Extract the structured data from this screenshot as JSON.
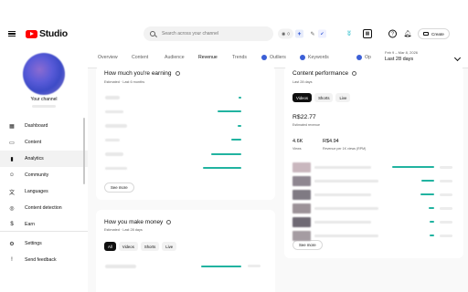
{
  "app": {
    "logo_text": "Studio"
  },
  "header": {
    "search_placeholder": "Search across your channel",
    "counter_value": "0",
    "create_label": "Create"
  },
  "sidebar": {
    "channel_name": "Your channel",
    "items": [
      {
        "label": "Dashboard",
        "icon": "dashboard-icon"
      },
      {
        "label": "Content",
        "icon": "content-icon"
      },
      {
        "label": "Analytics",
        "icon": "analytics-icon"
      },
      {
        "label": "Community",
        "icon": "community-icon"
      },
      {
        "label": "Languages",
        "icon": "languages-icon"
      },
      {
        "label": "Content detection",
        "icon": "content-detection-icon"
      },
      {
        "label": "Earn",
        "icon": "earn-icon"
      }
    ],
    "bottom_items": [
      {
        "label": "Settings",
        "icon": "gear-icon"
      },
      {
        "label": "Send feedback",
        "icon": "feedback-icon"
      }
    ],
    "active_index": 2
  },
  "tabs": {
    "items": [
      "Overview",
      "Content",
      "Audience",
      "Revenue",
      "Trends",
      "Outliers",
      "Keywords",
      "Op"
    ],
    "active": "Revenue",
    "date_range": "Feb 9 – Mar 8, 2026",
    "date_label": "Last 28 days"
  },
  "earning_card": {
    "title": "How much you're earning",
    "subtitle": "Estimated · Last 6 months",
    "bar_fractions": [
      0.06,
      0.6,
      0.1,
      0.24,
      0.74,
      0.96
    ],
    "see_more": "See more"
  },
  "money_card": {
    "title": "How you make money",
    "subtitle": "Estimated · Last 28 days",
    "chips": [
      "All",
      "Videos",
      "Shorts",
      "Live"
    ],
    "active_chip": "All",
    "bar_fractions": [
      1.0
    ]
  },
  "performance_card": {
    "title": "Content performance",
    "subtitle": "Last 28 days",
    "chips": [
      "Videos",
      "Shorts",
      "Live"
    ],
    "active_chip": "Videos",
    "revenue_value": "R$22.77",
    "revenue_label": "Estimated revenue",
    "views_value": "4.6K",
    "views_label": "Views",
    "rpm_value": "R$4.94",
    "rpm_label": "Revenue per 1K views (RPM)",
    "bar_fractions": [
      1.0,
      0.3,
      0.32,
      0.14,
      0.1,
      0.1
    ],
    "see_more": "See more"
  },
  "colors": {
    "accent_bar": "#21b3a0",
    "brand": "#ff0000"
  }
}
